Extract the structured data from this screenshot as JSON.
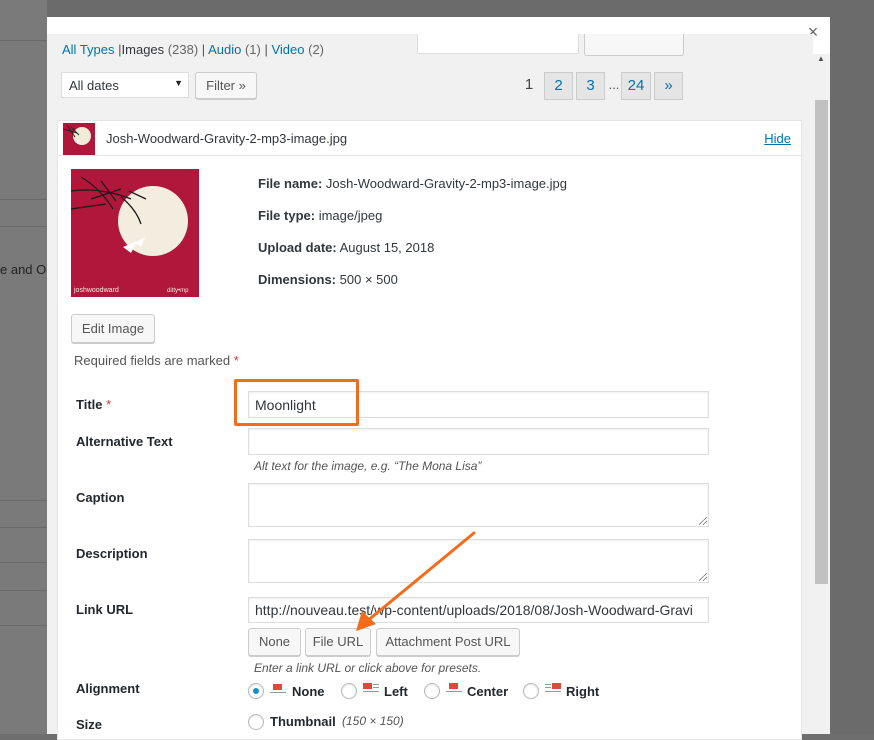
{
  "background": {
    "text": "e and Op"
  },
  "modal": {
    "close_symbol": "×"
  },
  "type_filters": {
    "all": "All Types",
    "images": "Images",
    "images_count": "(238)",
    "audio": "Audio",
    "audio_count": "(1)",
    "video": "Video",
    "video_count": "(2)",
    "separator": "|"
  },
  "filters": {
    "dates_value": "All dates",
    "filter_button": "Filter »"
  },
  "pagination": {
    "current": "1",
    "pages": [
      "2",
      "3",
      "24"
    ],
    "ellipsis": "...",
    "next": "»"
  },
  "file": {
    "header_name": "Josh-Woodward-Gravity-2-mp3-image.jpg",
    "hide_link": "Hide",
    "meta": [
      {
        "label": "File name:",
        "value": "Josh-Woodward-Gravity-2-mp3-image.jpg"
      },
      {
        "label": "File type:",
        "value": "image/jpeg"
      },
      {
        "label": "Upload date:",
        "value": "August 15, 2018"
      },
      {
        "label": "Dimensions:",
        "value": "500 × 500"
      }
    ],
    "thumb_caption_left": "joshwoodward",
    "thumb_caption_right": "ditty•mp",
    "edit_button": "Edit Image"
  },
  "form": {
    "required_note": "Required fields are marked",
    "required_star": "*",
    "title_label": "Title",
    "title_value": "Moonlight",
    "alt_label": "Alternative Text",
    "alt_value": "",
    "alt_help": "Alt text for the image, e.g. “The Mona Lisa”",
    "caption_label": "Caption",
    "description_label": "Description",
    "link_label": "Link URL",
    "link_value": "http://nouveau.test/wp-content/uploads/2018/08/Josh-Woodward-Gravi",
    "link_none": "None",
    "link_file": "File URL",
    "link_attachment": "Attachment Post URL",
    "link_help": "Enter a link URL or click above for presets.",
    "alignment_label": "Alignment",
    "alignment_options": [
      "None",
      "Left",
      "Center",
      "Right"
    ],
    "alignment_selected": "None",
    "size_label": "Size",
    "size_option": "Thumbnail",
    "size_dims": "(150 × 150)"
  },
  "colors": {
    "accent": "#0073aa",
    "required": "#dc3232",
    "annotation": "#f26c1b",
    "thumb_bg": "#b0173a"
  }
}
